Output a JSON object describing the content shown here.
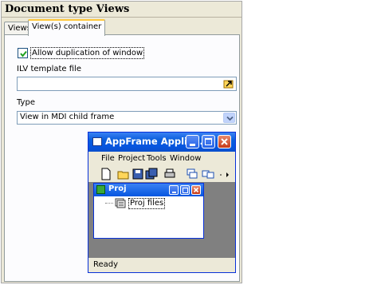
{
  "panel": {
    "title": "Document type Views",
    "tabs": [
      {
        "label": "Views",
        "active": false
      },
      {
        "label": "View(s) container",
        "active": true
      }
    ],
    "allow_duplication": {
      "label": "Allow duplication of window",
      "checked": true
    },
    "template": {
      "label": "ILV template file",
      "value": ""
    },
    "type": {
      "label": "Type",
      "selected": "View in MDI child frame"
    }
  },
  "preview": {
    "title": "AppFrame Applic...",
    "menu": [
      "File",
      "Project",
      "Tools",
      "Window"
    ],
    "child": {
      "title": "Proj",
      "tree_item": "Proj files"
    },
    "status": "Ready"
  },
  "colors": {
    "xp_blue": "#0a5ddb",
    "panel_bg": "#ece9d8",
    "field_border": "#7f9db9",
    "tab_highlight": "#ffc83c"
  }
}
